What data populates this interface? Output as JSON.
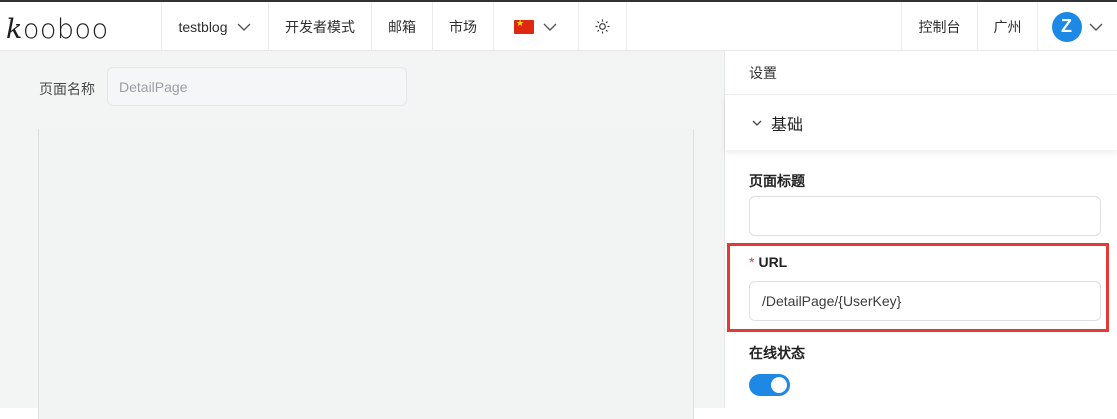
{
  "app": {
    "logo_text": "kooboo"
  },
  "topbar": {
    "site_selector": "testblog",
    "developer_mode": "开发者模式",
    "mail": "邮箱",
    "market": "市场",
    "language_flag": "cn-flag",
    "theme_icon": "sun-icon",
    "console": "控制台",
    "region": "广州",
    "avatar_initial": "Z"
  },
  "editor": {
    "page_name_label": "页面名称",
    "page_name_value": "DetailPage"
  },
  "settings_panel": {
    "title": "设置",
    "section": "基础",
    "page_title_label": "页面标题",
    "page_title_value": "",
    "url_label": "URL",
    "url_required_mark": "*",
    "url_value": "/DetailPage/{UserKey}",
    "online_status_label": "在线状态",
    "online_status": true
  },
  "colors": {
    "accent": "#1e88e5",
    "highlight": "#e53935"
  }
}
